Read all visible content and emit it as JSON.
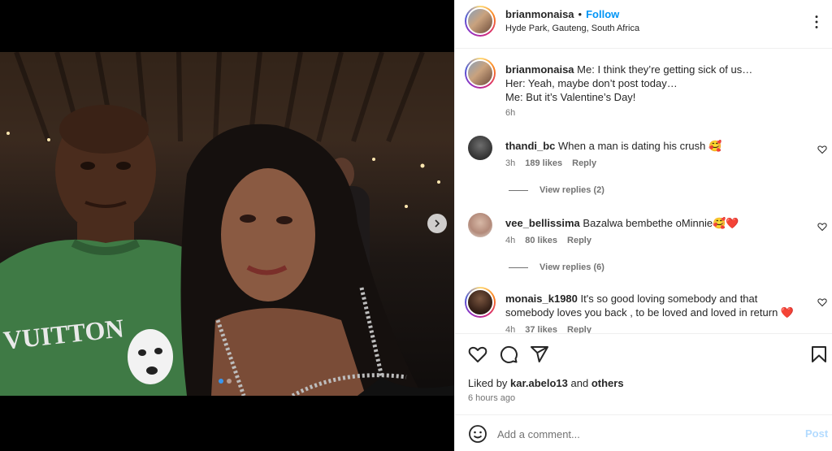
{
  "post": {
    "username": "brianmonaisa",
    "separator": "•",
    "follow_label": "Follow",
    "location": "Hyde Park, Gauteng, South Africa",
    "caption_lines": [
      "Me: I think they’re getting sick of us…",
      "Her: Yeah, maybe don’t post today…",
      "Me: But it’s Valentine’s Day!"
    ],
    "caption_age": "6h",
    "carousel": {
      "slides": 2,
      "current": 1
    }
  },
  "comments": [
    {
      "username": "thandi_bc",
      "text": "When a man is dating his crush 🥰",
      "age": "3h",
      "likes": "189 likes",
      "reply_label": "Reply",
      "view_replies": "View replies (2)"
    },
    {
      "username": "vee_bellissima",
      "text": "Bazalwa bembethe oMinnie🥰❤️",
      "age": "4h",
      "likes": "80 likes",
      "reply_label": "Reply",
      "view_replies": "View replies (6)"
    },
    {
      "username": "monais_k1980",
      "text": "It's so good loving somebody and that somebody loves you back , to be loved and loved in return ❤️",
      "age": "4h",
      "likes": "37 likes",
      "reply_label": "Reply"
    }
  ],
  "likes_summary": {
    "prefix": "Liked by",
    "user": "kar.abelo13",
    "conj": "and",
    "others": "others"
  },
  "post_time": "6 hours ago",
  "composer": {
    "placeholder": "Add a comment...",
    "post_label": "Post"
  },
  "colors": {
    "accent": "#0095f6",
    "post_disabled": "#b3dbff",
    "heart_red": "#ed4956",
    "secondary_text": "#737373"
  },
  "icons": [
    "more-icon",
    "heart-icon",
    "comment-icon",
    "share-icon",
    "bookmark-icon",
    "emoji-icon",
    "chevron-right-icon"
  ]
}
